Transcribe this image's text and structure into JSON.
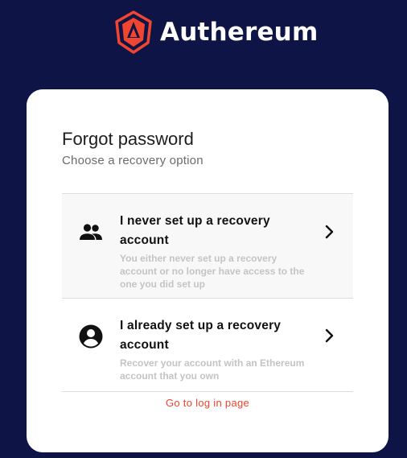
{
  "brand": {
    "name": "Authereum",
    "logo_icon": "authereum-logo-icon",
    "accent_color": "#f0452e",
    "background_color": "#0f1447"
  },
  "card": {
    "title": "Forgot password",
    "subtitle": "Choose a recovery option",
    "options": [
      {
        "icon": "people-icon",
        "title": "I never set up a recovery account",
        "description": "You either never set up a recovery account or no longer have access to the one you did set up",
        "chevron_icon": "chevron-right-icon"
      },
      {
        "icon": "account-circle-icon",
        "title": "I already set up a recovery account",
        "description": "Recover your account with an Ethereum account that you own",
        "chevron_icon": "chevron-right-icon"
      }
    ],
    "login_link": "Go to log in page"
  }
}
